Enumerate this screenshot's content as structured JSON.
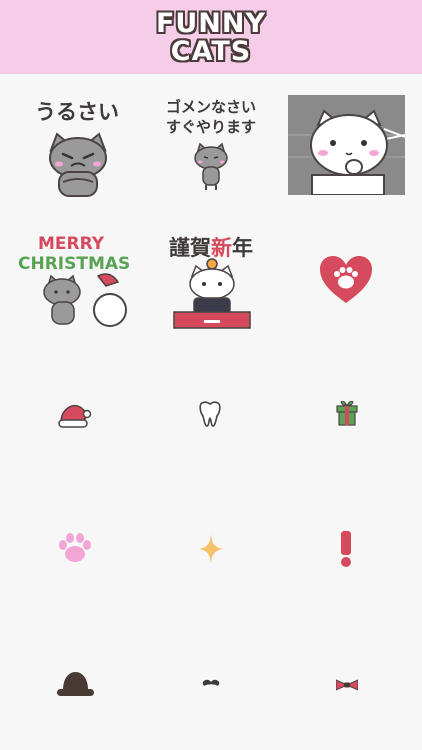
{
  "app": {
    "title_line1": "FUNNY",
    "title_line2": "CATS"
  },
  "stickers": [
    {
      "text": "うるさい",
      "icon": "angry-gray-cat"
    },
    {
      "text_line1": "ゴメンなさい",
      "text_line2": "すぐやります",
      "icon": "gray-cat-apologizing"
    },
    {
      "icon": "white-cat-thinking-gray-panel"
    },
    {
      "text": "MERRY CHRISTMAS",
      "word1": "MERRY",
      "word2": "CHRISTMAS",
      "icon": "gray-cat-santa-bag"
    },
    {
      "text_part1": "謹賀",
      "text_part2": "新",
      "text_part3": "年",
      "icon": "white-cat-new-year"
    },
    {
      "icon": "heart-paw-icon"
    },
    {
      "icon": "santa-hat-icon"
    },
    {
      "icon": "tooth-icon"
    },
    {
      "icon": "gift-box-icon"
    },
    {
      "icon": "pink-paw-icon"
    },
    {
      "icon": "sparkle-icon"
    },
    {
      "icon": "exclamation-icon"
    },
    {
      "icon": "bowler-hat-icon"
    },
    {
      "icon": "mustache-icon"
    },
    {
      "icon": "bow-tie-icon"
    }
  ],
  "colors": {
    "header_bg": "#f6cde9",
    "accent_red": "#d64a5d",
    "gray_cat": "#9a9a9a",
    "dark_text": "#3f3a3a",
    "pink": "#f3a6d6",
    "green": "#5aa355",
    "gold": "#f5c16b"
  }
}
